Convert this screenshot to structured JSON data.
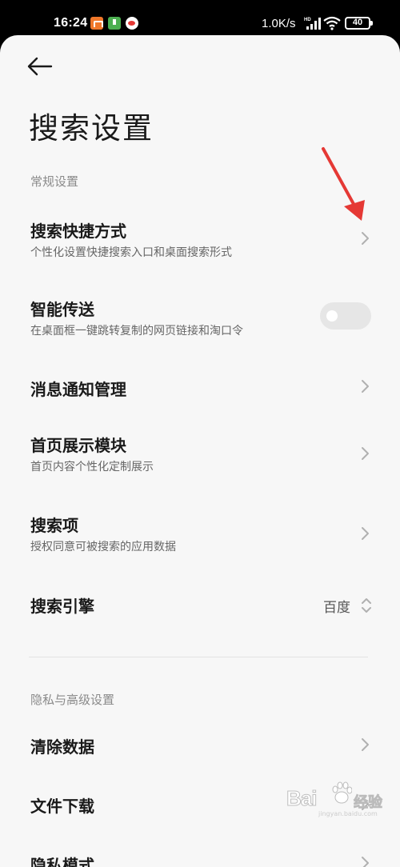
{
  "status_bar": {
    "time": "16:24",
    "network_speed": "1.0K/s",
    "battery": "40",
    "icons": [
      "mi-app-icon",
      "download-app-icon",
      "weibo-app-icon",
      "signal-icon",
      "wifi-icon",
      "battery-icon"
    ]
  },
  "header": {
    "back_icon": "arrow-left-icon",
    "title": "搜索设置"
  },
  "sections": {
    "general": {
      "label": "常规设置",
      "items": [
        {
          "title": "搜索快捷方式",
          "subtitle": "个性化设置快捷搜索入口和桌面搜索形式",
          "control": "chevron"
        },
        {
          "title": "智能传送",
          "subtitle": "在桌面框一键跳转复制的网页链接和淘口令",
          "control": "toggle",
          "toggle_on": false
        },
        {
          "title": "消息通知管理",
          "control": "chevron"
        },
        {
          "title": "首页展示模块",
          "subtitle": "首页内容个性化定制展示",
          "control": "chevron"
        },
        {
          "title": "搜索项",
          "subtitle": "授权同意可被搜索的应用数据",
          "control": "chevron"
        },
        {
          "title": "搜索引擎",
          "value": "百度",
          "control": "select"
        }
      ]
    },
    "privacy": {
      "label": "隐私与高级设置",
      "items": [
        {
          "title": "清除数据",
          "control": "chevron"
        },
        {
          "title": "文件下载",
          "control": "chevron"
        },
        {
          "title": "隐私模式",
          "control": "chevron"
        }
      ]
    }
  },
  "colors": {
    "background": "#f7f7f7",
    "text_primary": "#1a1a1a",
    "text_secondary": "#666666",
    "section_label": "#8a8a8a",
    "annotation_arrow": "#e53935",
    "toggle_off": "#e6e6e6"
  },
  "watermark": {
    "text": "Bai",
    "suffix": "经验",
    "url": "jingyan.baidu.com"
  }
}
